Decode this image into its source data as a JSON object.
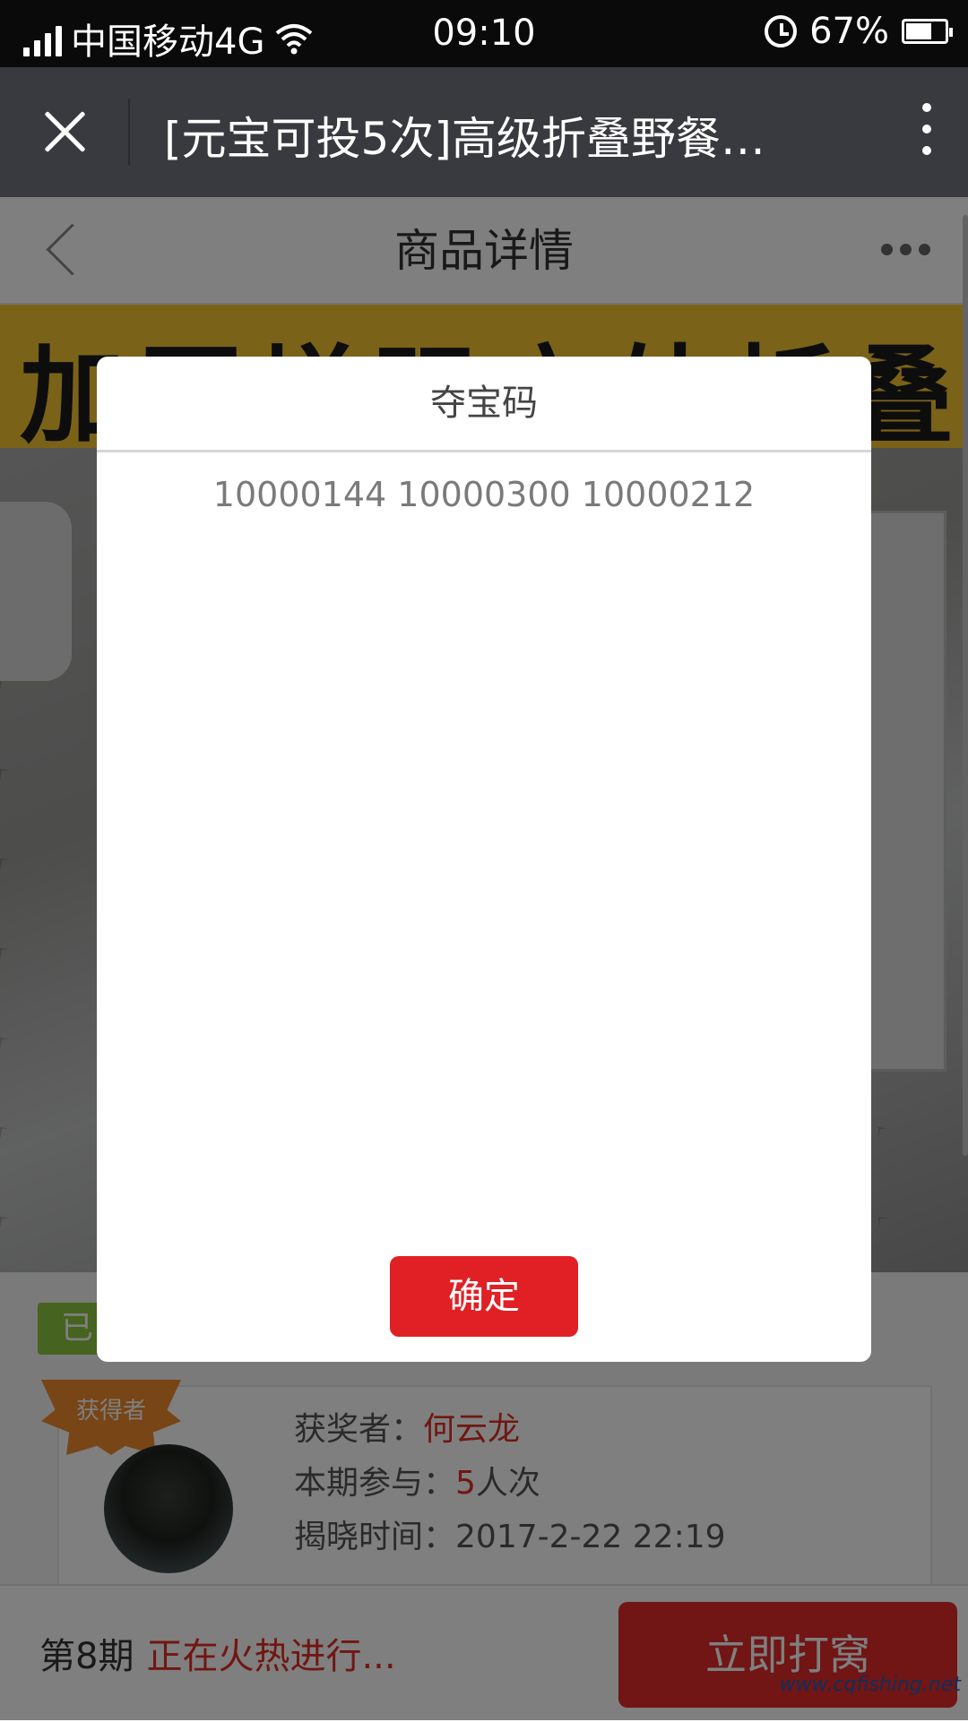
{
  "status_bar": {
    "carrier": "中国移动4G",
    "time": "09:10",
    "battery": "67%",
    "battery_level": 0.67
  },
  "wechat_bar": {
    "title": "[元宝可投5次]高级折叠野餐…"
  },
  "nav": {
    "title": "商品详情"
  },
  "product": {
    "banner_text": "加固增强户外折叠桌",
    "status_tag": "已"
  },
  "winner": {
    "badge": "获得者",
    "winner_label": "获奖者：",
    "winner_name": "何云龙",
    "participation_label": "本期参与：",
    "participation_count": "5",
    "participation_unit": "人次",
    "reveal_label": "揭晓时间：",
    "reveal_time": "2017-2-22 22:19"
  },
  "bottom_bar": {
    "period": "第8期",
    "status": "正在火热进行...",
    "button_label": "立即打窝"
  },
  "watermark": "www.cqfishing.net",
  "modal": {
    "title": "夺宝码",
    "codes": "10000144 10000300 10000212",
    "confirm_label": "确定"
  }
}
